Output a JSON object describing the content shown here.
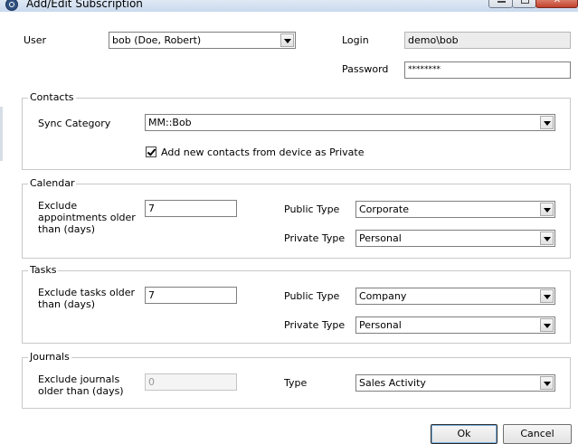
{
  "window": {
    "title": "Add/Edit Subscription"
  },
  "user": {
    "label": "User",
    "value": "bob (Doe, Robert)"
  },
  "login": {
    "label": "Login",
    "value": "demo\\bob"
  },
  "password": {
    "label": "Password",
    "value": "********"
  },
  "contacts": {
    "group_title": "Contacts",
    "sync_category_label": "Sync Category",
    "sync_category_value": "MM::Bob",
    "add_private_label": "Add new contacts from device as Private",
    "add_private_checked": true
  },
  "calendar": {
    "group_title": "Calendar",
    "exclude_label": "Exclude appointments older than (days)",
    "exclude_value": "7",
    "public_type_label": "Public Type",
    "public_type_value": "Corporate",
    "private_type_label": "Private Type",
    "private_type_value": "Personal"
  },
  "tasks": {
    "group_title": "Tasks",
    "exclude_label": "Exclude tasks older than (days)",
    "exclude_value": "7",
    "public_type_label": "Public Type",
    "public_type_value": "Company",
    "private_type_label": "Private Type",
    "private_type_value": "Personal"
  },
  "journals": {
    "group_title": "Journals",
    "exclude_label": "Exclude journals older than (days)",
    "exclude_value": "0",
    "type_label": "Type",
    "type_value": "Sales Activity"
  },
  "buttons": {
    "ok": "Ok",
    "cancel": "Cancel"
  }
}
